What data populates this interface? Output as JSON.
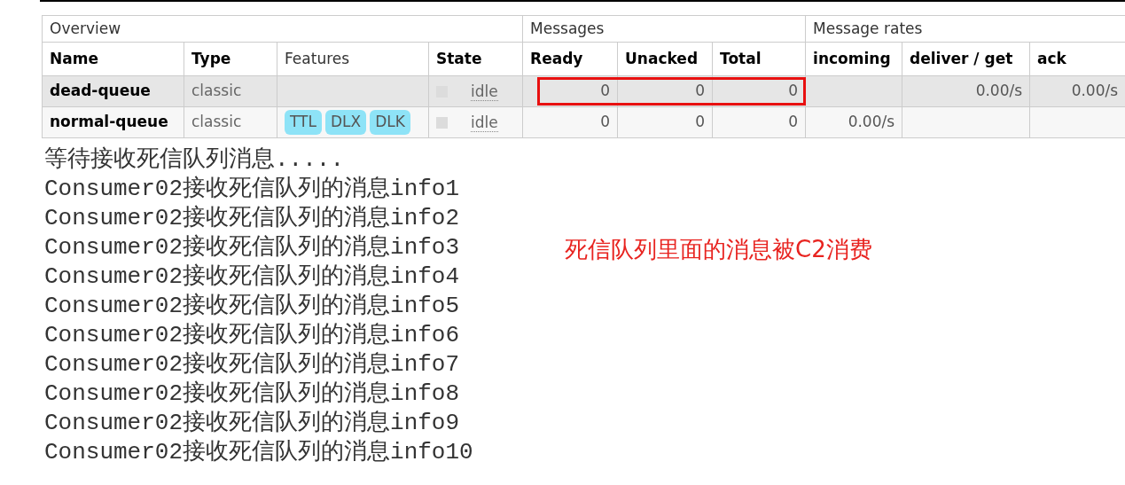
{
  "queues_table": {
    "groups": [
      {
        "label": "Overview"
      },
      {
        "label": "Messages"
      },
      {
        "label": "Message rates"
      }
    ],
    "columns": [
      {
        "label": "Name",
        "bold": true
      },
      {
        "label": "Type",
        "bold": true
      },
      {
        "label": "Features",
        "bold": false
      },
      {
        "label": "State",
        "bold": true
      },
      {
        "label": "Ready",
        "bold": true
      },
      {
        "label": "Unacked",
        "bold": true
      },
      {
        "label": "Total",
        "bold": true
      },
      {
        "label": "incoming",
        "bold": true
      },
      {
        "label": "deliver / get",
        "bold": true
      },
      {
        "label": "ack",
        "bold": true
      }
    ],
    "rows": [
      {
        "name": "dead-queue",
        "type": "classic",
        "features": [],
        "state": "idle",
        "ready": "0",
        "unacked": "0",
        "total": "0",
        "incoming": "",
        "deliver_get": "0.00/s",
        "ack": "0.00/s",
        "messages_highlighted": true
      },
      {
        "name": "normal-queue",
        "type": "classic",
        "features": [
          "TTL",
          "DLX",
          "DLK"
        ],
        "state": "idle",
        "ready": "0",
        "unacked": "0",
        "total": "0",
        "incoming": "0.00/s",
        "deliver_get": "",
        "ack": "",
        "messages_highlighted": false
      }
    ]
  },
  "console": {
    "lines": [
      "等待接收死信队列消息.....",
      "Consumer02接收死信队列的消息info1",
      "Consumer02接收死信队列的消息info2",
      "Consumer02接收死信队列的消息info3",
      "Consumer02接收死信队列的消息info4",
      "Consumer02接收死信队列的消息info5",
      "Consumer02接收死信队列的消息info6",
      "Consumer02接收死信队列的消息info7",
      "Consumer02接收死信队列的消息info8",
      "Consumer02接收死信队列的消息info9",
      "Consumer02接收死信队列的消息info10"
    ]
  },
  "annotation": "死信队列里面的消息被C2消费"
}
